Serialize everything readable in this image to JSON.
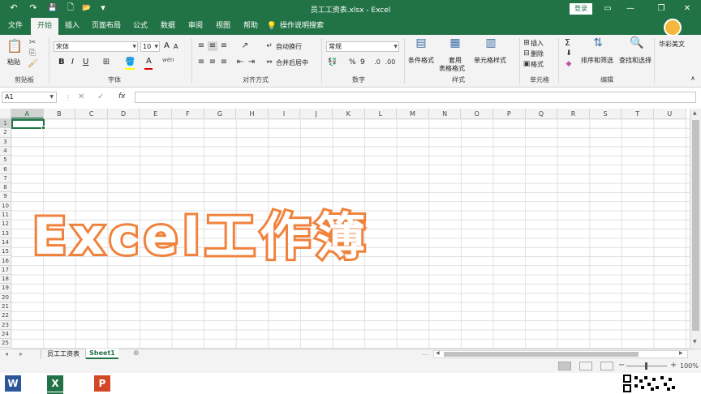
{
  "window": {
    "title": "员工工资表.xlsx  -  Excel",
    "login_label": "登录",
    "minimize": "—",
    "restore": "❐",
    "close": "✕",
    "ribbon_display": "▭"
  },
  "quick_access": {
    "undo": "↶",
    "redo": "↷",
    "save": "💾",
    "new": "🗋",
    "open": "📂",
    "more": "▾"
  },
  "tabs": [
    "文件",
    "开始",
    "插入",
    "页面布局",
    "公式",
    "数据",
    "审阅",
    "视图",
    "帮助"
  ],
  "tell_me": "操作说明搜索",
  "brand": {
    "name": "华彩美文"
  },
  "ribbon": {
    "clipboard": {
      "paste": "粘贴",
      "label": "剪贴板"
    },
    "font": {
      "font_name": "宋体",
      "font_size": "10",
      "bold": "B",
      "italic": "I",
      "underline": "U",
      "grow": "A",
      "shrink": "A",
      "font_color_letter": "A",
      "label": "字体",
      "phonetic": "wén"
    },
    "alignment": {
      "wrap": "自动换行",
      "merge": "合并后居中",
      "label": "对齐方式"
    },
    "number": {
      "format": "常规",
      "percent": "%",
      "comma": "9",
      "label": "数字"
    },
    "styles": {
      "conditional": "条件格式",
      "table": "套用\n表格格式",
      "table_line1": "套用",
      "table_line2": "表格格式",
      "cell_styles": "单元格样式",
      "label": "样式"
    },
    "cells": {
      "insert": "插入",
      "delete": "删除",
      "format": "格式",
      "label": "单元格"
    },
    "editing": {
      "sum": "Σ",
      "sort": "排序和筛选",
      "find": "查找和选择",
      "label": "编辑"
    }
  },
  "formula_bar": {
    "name_box": "A1",
    "cancel": "✕",
    "enter": "✓",
    "fx": "fx",
    "value": ""
  },
  "columns": [
    "A",
    "B",
    "C",
    "D",
    "E",
    "F",
    "G",
    "H",
    "I",
    "J",
    "K",
    "L",
    "M",
    "N",
    "O",
    "P",
    "Q",
    "R",
    "S",
    "T",
    "U"
  ],
  "rows": [
    "1",
    "2",
    "3",
    "4",
    "5",
    "6",
    "7",
    "8",
    "9",
    "10",
    "11",
    "12",
    "13",
    "14",
    "15",
    "16",
    "17",
    "18",
    "19",
    "20",
    "21",
    "22",
    "23",
    "24",
    "25"
  ],
  "sheets": {
    "nav_prev": "◂",
    "nav_next": "▸",
    "tab1": "员工工资表",
    "tab2": "Sheet1",
    "add": "⊕",
    "ellipsis": "..."
  },
  "status": {
    "zoom": "100%",
    "minus": "−",
    "plus": "+"
  },
  "overlay": "Excel工作簿",
  "taskbar": {
    "word": "W",
    "excel": "X",
    "powerpoint": "P"
  },
  "colors": {
    "excel_green": "#217346",
    "overlay_orange": "#f0823c"
  }
}
